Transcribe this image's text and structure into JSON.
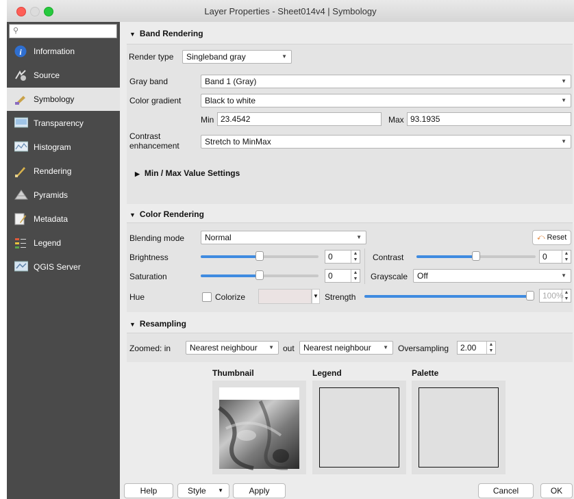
{
  "window": {
    "title": "Layer Properties - Sheet014v4 | Symbology"
  },
  "sidebar": {
    "search_icon": "search-icon",
    "items": [
      {
        "label": "Information",
        "icon": "info-icon"
      },
      {
        "label": "Source",
        "icon": "source-icon"
      },
      {
        "label": "Symbology",
        "icon": "symbology-icon"
      },
      {
        "label": "Transparency",
        "icon": "transparency-icon"
      },
      {
        "label": "Histogram",
        "icon": "histogram-icon"
      },
      {
        "label": "Rendering",
        "icon": "rendering-icon"
      },
      {
        "label": "Pyramids",
        "icon": "pyramids-icon"
      },
      {
        "label": "Metadata",
        "icon": "metadata-icon"
      },
      {
        "label": "Legend",
        "icon": "legend-icon"
      },
      {
        "label": "QGIS Server",
        "icon": "qgis-server-icon"
      }
    ],
    "selected": "Symbology"
  },
  "band_rendering": {
    "title": "Band Rendering",
    "render_type_label": "Render type",
    "render_type": "Singleband gray",
    "gray_band_label": "Gray band",
    "gray_band": "Band 1 (Gray)",
    "color_gradient_label": "Color gradient",
    "color_gradient": "Black to white",
    "min_label": "Min",
    "min_value": "23.4542",
    "max_label": "Max",
    "max_value": "93.1935",
    "contrast_label_1": "Contrast",
    "contrast_label_2": "enhancement",
    "contrast_enhancement": "Stretch to MinMax",
    "minmax_settings": "Min / Max Value Settings"
  },
  "color_rendering": {
    "title": "Color Rendering",
    "blending_mode_label": "Blending mode",
    "blending_mode": "Normal",
    "reset_label": "Reset",
    "brightness_label": "Brightness",
    "brightness_value": "0",
    "brightness_level": 0.5,
    "contrast_label": "Contrast",
    "contrast_value": "0",
    "contrast_level": 0.5,
    "saturation_label": "Saturation",
    "saturation_value": "0",
    "saturation_level": 0.5,
    "grayscale_label": "Grayscale",
    "grayscale": "Off",
    "hue_label": "Hue",
    "colorize_label": "Colorize",
    "colorize_checked": false,
    "strength_label": "Strength",
    "strength_value": "100%",
    "strength_level": 1.0
  },
  "resampling": {
    "title": "Resampling",
    "zoomed_in_label": "Zoomed: in",
    "zoomed_in": "Nearest neighbour",
    "out_label": "out",
    "zoomed_out": "Nearest neighbour",
    "oversampling_label": "Oversampling",
    "oversampling": "2.00"
  },
  "previews": {
    "thumbnail_label": "Thumbnail",
    "legend_label": "Legend",
    "palette_label": "Palette"
  },
  "buttons": {
    "help": "Help",
    "style": "Style",
    "apply": "Apply",
    "cancel": "Cancel",
    "ok": "OK"
  },
  "colors": {
    "accent": "#3f8be0",
    "sidebar_bg": "#4a4a4a",
    "close": "#fe5f57",
    "zoom": "#27c93f"
  }
}
